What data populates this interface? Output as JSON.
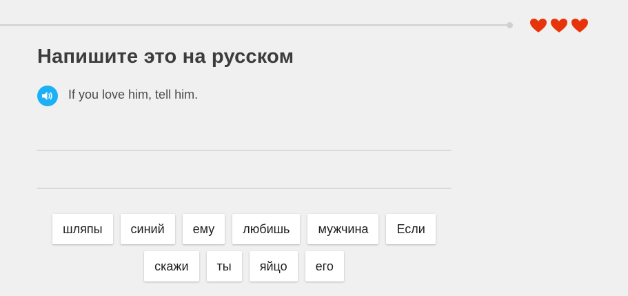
{
  "progress": {
    "fraction": 1.0
  },
  "hearts": {
    "count": 3,
    "icon": "heart-icon",
    "color": "#e8340b"
  },
  "exercise": {
    "title": "Напишите это на русском",
    "prompt": "If you love him, tell him.",
    "audio_icon": "speaker-icon",
    "accent": "#1cb0f6"
  },
  "word_bank": [
    "шляпы",
    "синий",
    "ему",
    "любишь",
    "мужчина",
    "Если",
    "скажи",
    "ты",
    "яйцо",
    "его"
  ]
}
